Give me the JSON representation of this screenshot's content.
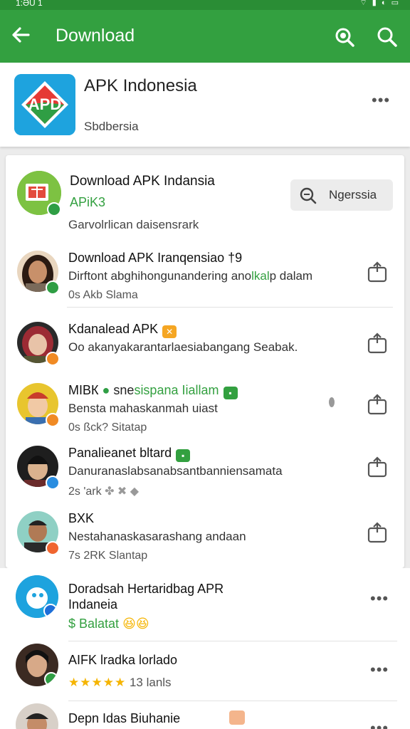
{
  "status": {
    "time": "1:ƏU 1"
  },
  "appbar": {
    "title": "Download"
  },
  "app": {
    "name": "APK Indonesia",
    "subtitle": "Sbdbersia",
    "logo_text": "APD"
  },
  "group": {
    "title": "Download APK Indansia",
    "subtitle": "APiK3",
    "description": "Garvolrlican daisensrark",
    "button_label": "Ngerssia"
  },
  "posts": [
    {
      "title": "Download APK Iranqensiao †9",
      "desc_a": "Dirftont abghihongunandering ano",
      "desc_b": "lkal",
      "desc_c": "p dalam",
      "meta": "0s   Akb Slama"
    },
    {
      "title": "Kdanalead APK",
      "desc": "Oo akanyakarantarlaesiabangang Seabak.",
      "meta": ""
    },
    {
      "title": "MI",
      "title_b": "ВК",
      "title_hl": "snesispana Iiallam",
      "desc": "Bensta mahaskanmah uiast",
      "meta": "0s   ßck? Sitatap"
    },
    {
      "title": "Panalieanet bltard",
      "desc": "Danuranaslabsanabsantbanniensamata",
      "meta": "2s   'ark"
    },
    {
      "title": "BXK",
      "desc": "Nestahanaskasarashang andaan",
      "meta": "7s   2RK Slantap"
    }
  ],
  "lower": [
    {
      "title_a": "Doradsah Hertaridbag APR",
      "title_b": "Indaneia",
      "sub": "$ Balatat"
    },
    {
      "title": "AIFK lradka lorlado",
      "rating": "13",
      "rating_label": "lanls"
    },
    {
      "title": "Depn Idas Biuhanie"
    }
  ],
  "colors": {
    "primary": "#33a040",
    "statusbar": "#2a8d35",
    "accent": "#f08a24"
  }
}
